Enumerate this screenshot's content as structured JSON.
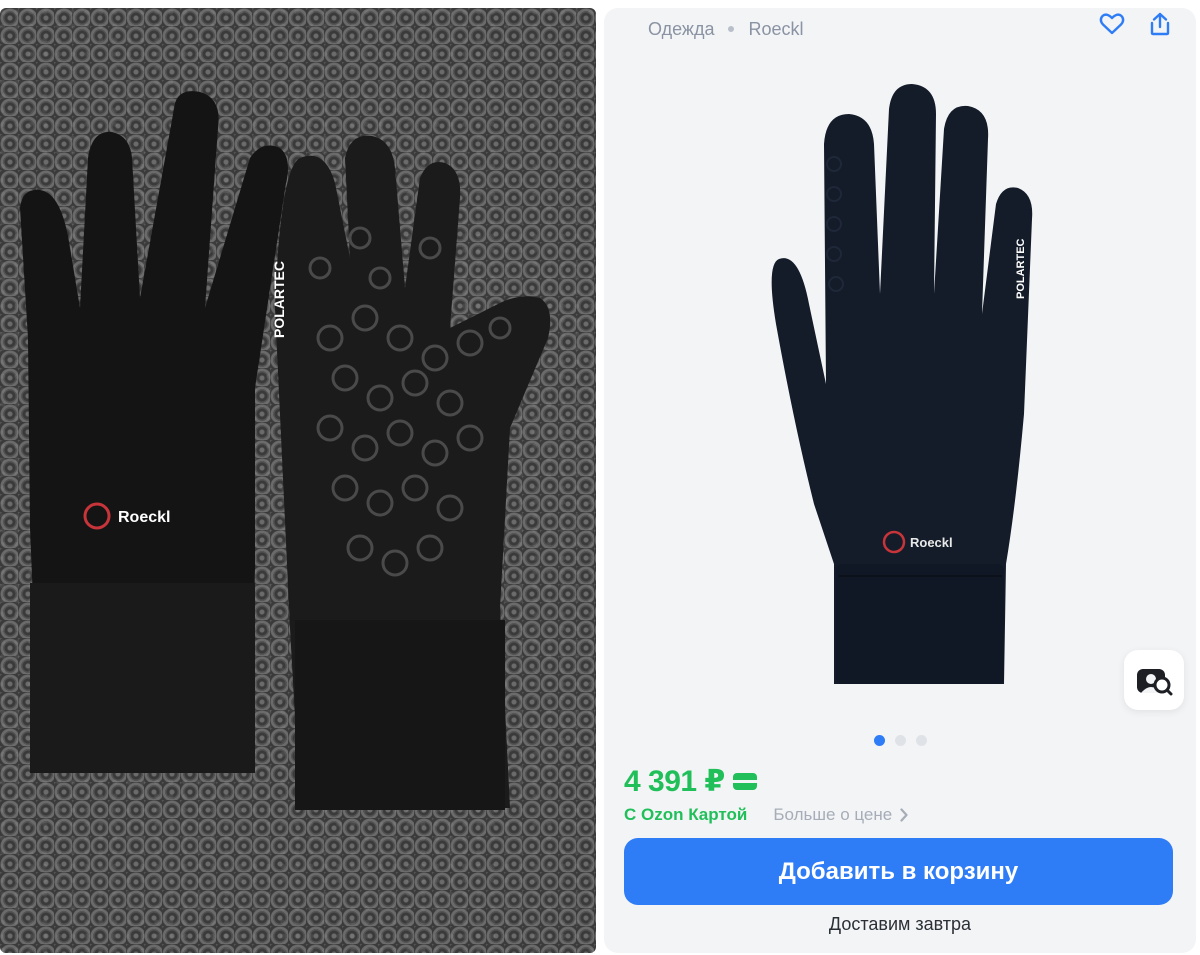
{
  "breadcrumb": {
    "category": "Одежда",
    "brand": "Roeckl"
  },
  "photo": {
    "brand_logo_text": "Roeckl",
    "fabric_text": "POLARTEC"
  },
  "product": {
    "price": "4 391 ₽",
    "price_note": "С Ozon Картой",
    "more_price": "Больше о цене",
    "add_to_cart": "Добавить в корзину",
    "delivery": "Доставим завтра",
    "gallery_pages": 3,
    "gallery_current": 1
  },
  "icons": [
    "heart-icon",
    "share-icon",
    "visual-search-icon",
    "chevron-right-icon",
    "ozon-card-icon"
  ],
  "colors": {
    "accent": "#2f7df6",
    "price_green": "#21bf5a",
    "card_bg": "#f3f4f6"
  }
}
